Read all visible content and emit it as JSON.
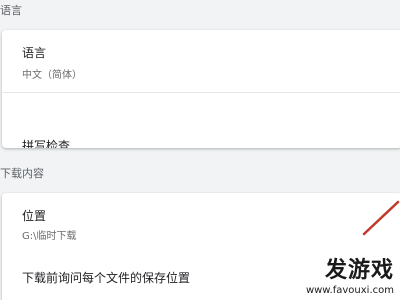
{
  "sections": {
    "language": {
      "title": "语言",
      "language_row": {
        "label": "语言",
        "value": "中文（简体）"
      },
      "spellcheck_row": {
        "label": "拼写检查"
      }
    },
    "downloads": {
      "title": "下载内容",
      "location_row": {
        "label": "位置",
        "value": "G:\\临时下载"
      },
      "ask_row": {
        "label": "下载前询问每个文件的保存位置"
      }
    }
  },
  "watermark": {
    "brand": "发游戏",
    "url": "www.favouxi.com"
  },
  "colors": {
    "background": "#f1f3f4",
    "card": "#ffffff",
    "annotation_red": "#c0392b",
    "watermark_orange": "#f28c28"
  }
}
